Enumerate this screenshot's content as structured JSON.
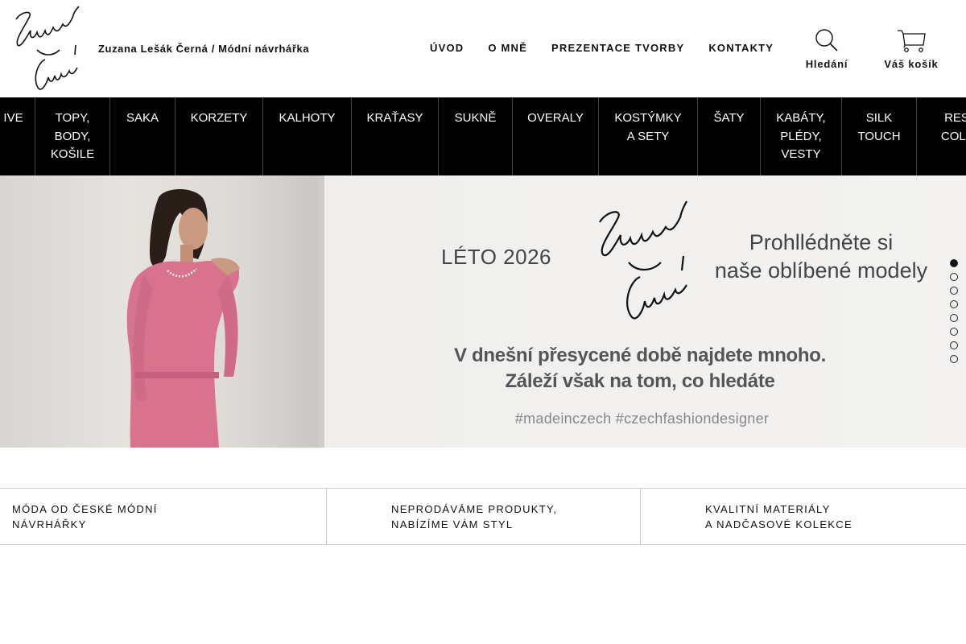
{
  "header": {
    "tagline": "Zuzana Lešák Černá / Módní návrhářka",
    "nav": [
      {
        "label": "ÚVOD"
      },
      {
        "label": "O MNĚ"
      },
      {
        "label": "PREZENTACE TVORBY"
      },
      {
        "label": "KONTAKTY"
      }
    ],
    "search_label": "Hledání",
    "cart_label": "Váš košík",
    "search_icon": "magnifier-icon",
    "cart_icon": "shopping-cart-icon"
  },
  "categories": [
    {
      "label": "IVE"
    },
    {
      "label": "TOPY,\nBODY,\nKOŠILE"
    },
    {
      "label": "SAKA"
    },
    {
      "label": "KORZETY"
    },
    {
      "label": "KALHOTY"
    },
    {
      "label": "KRAŤASY"
    },
    {
      "label": "SUKNĚ"
    },
    {
      "label": "OVERALY"
    },
    {
      "label": "KOSTÝMKY\nA SETY"
    },
    {
      "label": "ŠATY"
    },
    {
      "label": "KABÁTY,\nPLÉDY,\nVESTY"
    },
    {
      "label": "SILK\nTOUCH"
    },
    {
      "label": "RES\nCOLL"
    }
  ],
  "hero": {
    "season": "LÉTO 2026",
    "cta": "Prohllédněte si\nnaše oblíbené modely",
    "quote": "V dnešní přesycené době najdete mnoho.\nZáleží však na tom, co hledáte",
    "tags": "#madeinczech #czechfashiondesigner",
    "slides_total": 8,
    "active_slide": 1
  },
  "usp": [
    {
      "text": "MÓDA OD ČESKÉ MÓDNÍ\nNÁVRHÁŘKY"
    },
    {
      "text": "NEPRODÁVÁME PRODUKTY,\nNABÍZÍME VÁM STYL"
    },
    {
      "text": "KVALITNÍ MATERIÁLY\nA NADČASOVÉ KOLEKCE"
    }
  ],
  "colors": {
    "category_bar": "#000000",
    "dress_pink": "#d9728f"
  }
}
